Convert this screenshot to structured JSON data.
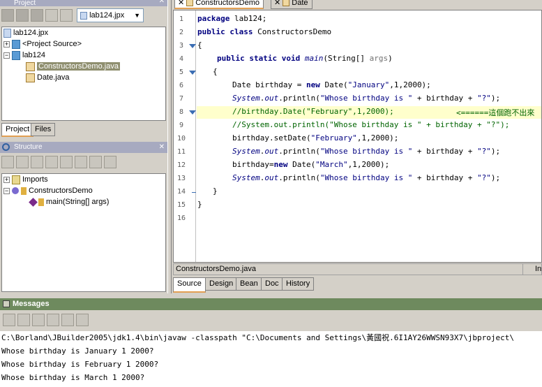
{
  "project_panel": {
    "title": "Project",
    "project_combo": "lab124.jpx",
    "tree": {
      "root": "lab124.jpx",
      "project_source": "<Project Source>",
      "package": "lab124",
      "file1": "ConstructorsDemo.java",
      "file2": "Date.java"
    },
    "tabs": [
      "Project",
      "Files"
    ]
  },
  "structure_panel": {
    "title": "Structure",
    "tree": {
      "imports": "Imports",
      "class": "ConstructorsDemo",
      "method": "main(String[] args)"
    }
  },
  "editor": {
    "tabs": [
      "ConstructorsDemo",
      "Date"
    ],
    "line_numbers": [
      "1",
      "2",
      "3",
      "4",
      "5",
      "6",
      "7",
      "8",
      "9",
      "10",
      "11",
      "12",
      "13",
      "14",
      "15",
      "16"
    ],
    "lines": {
      "l1_kw": "package",
      "l1_rest": " lab124;",
      "l2_kw1": "public",
      "l2_kw2": " class",
      "l2_rest": " ConstructorsDemo",
      "l3": "{",
      "l4_kw": "public static void",
      "l4_m": " main",
      "l4_a": "(String[] ",
      "l4_b": "args",
      "l4_c": ")",
      "l5": "{",
      "l6_a": "Date birthday = ",
      "l6_kw": "new",
      "l6_b": " Date(",
      "l6_s": "\"January\"",
      "l6_c": ",1,2000);",
      "l7_a": "System",
      "l7_b": ".",
      "l7_c": "out",
      "l7_d": ".println(",
      "l7_s1": "\"Whose birthday is \"",
      "l7_e": " + birthday + ",
      "l7_s2": "\"?\"",
      "l7_f": ");",
      "l8": "//birthday.Date(\"February\",1,2000);",
      "l8_note": "<======這個跑不出來",
      "l9": "//System.out.println(\"Whose birthday is \" + birthday + \"?\");",
      "l10_a": "birthday.setDate(",
      "l10_s": "\"February\"",
      "l10_b": ",1,2000);",
      "l11_a": "System",
      "l11_b": ".",
      "l11_c": "out",
      "l11_d": ".println(",
      "l11_s1": "\"Whose birthday is \"",
      "l11_e": " + birthday + ",
      "l11_s2": "\"?\"",
      "l11_f": ");",
      "l12_a": "birthday=",
      "l12_kw": "new",
      "l12_b": " Date(",
      "l12_s": "\"March\"",
      "l12_c": ",1,2000);",
      "l13_a": "System",
      "l13_b": ".",
      "l13_c": "out",
      "l13_d": ".println(",
      "l13_s1": "\"Whose birthday is \"",
      "l13_e": " + birthday + ",
      "l13_s2": "\"?\"",
      "l13_f": ");",
      "l14": "}",
      "l15": "}"
    },
    "status_file": "ConstructorsDemo.java",
    "status_right": "Ins",
    "bottom_tabs": [
      "Source",
      "Design",
      "Bean",
      "Doc",
      "History"
    ]
  },
  "messages": {
    "title": "Messages",
    "lines": [
      "C:\\Borland\\JBuilder2005\\jdk1.4\\bin\\javaw -classpath \"C:\\Documents and Settings\\黃國祝.6I1AY26WWSN93X7\\jbproject\\",
      "Whose birthday is January 1 2000?",
      "Whose birthday is February 1 2000?",
      "Whose birthday is March 1 2000?"
    ]
  },
  "colors": {
    "accent_tab": "#e29f52",
    "selection": "#8f8f6f",
    "keyword": "#000080",
    "comment": "#006400",
    "highlight_line": "#ffffcc"
  }
}
